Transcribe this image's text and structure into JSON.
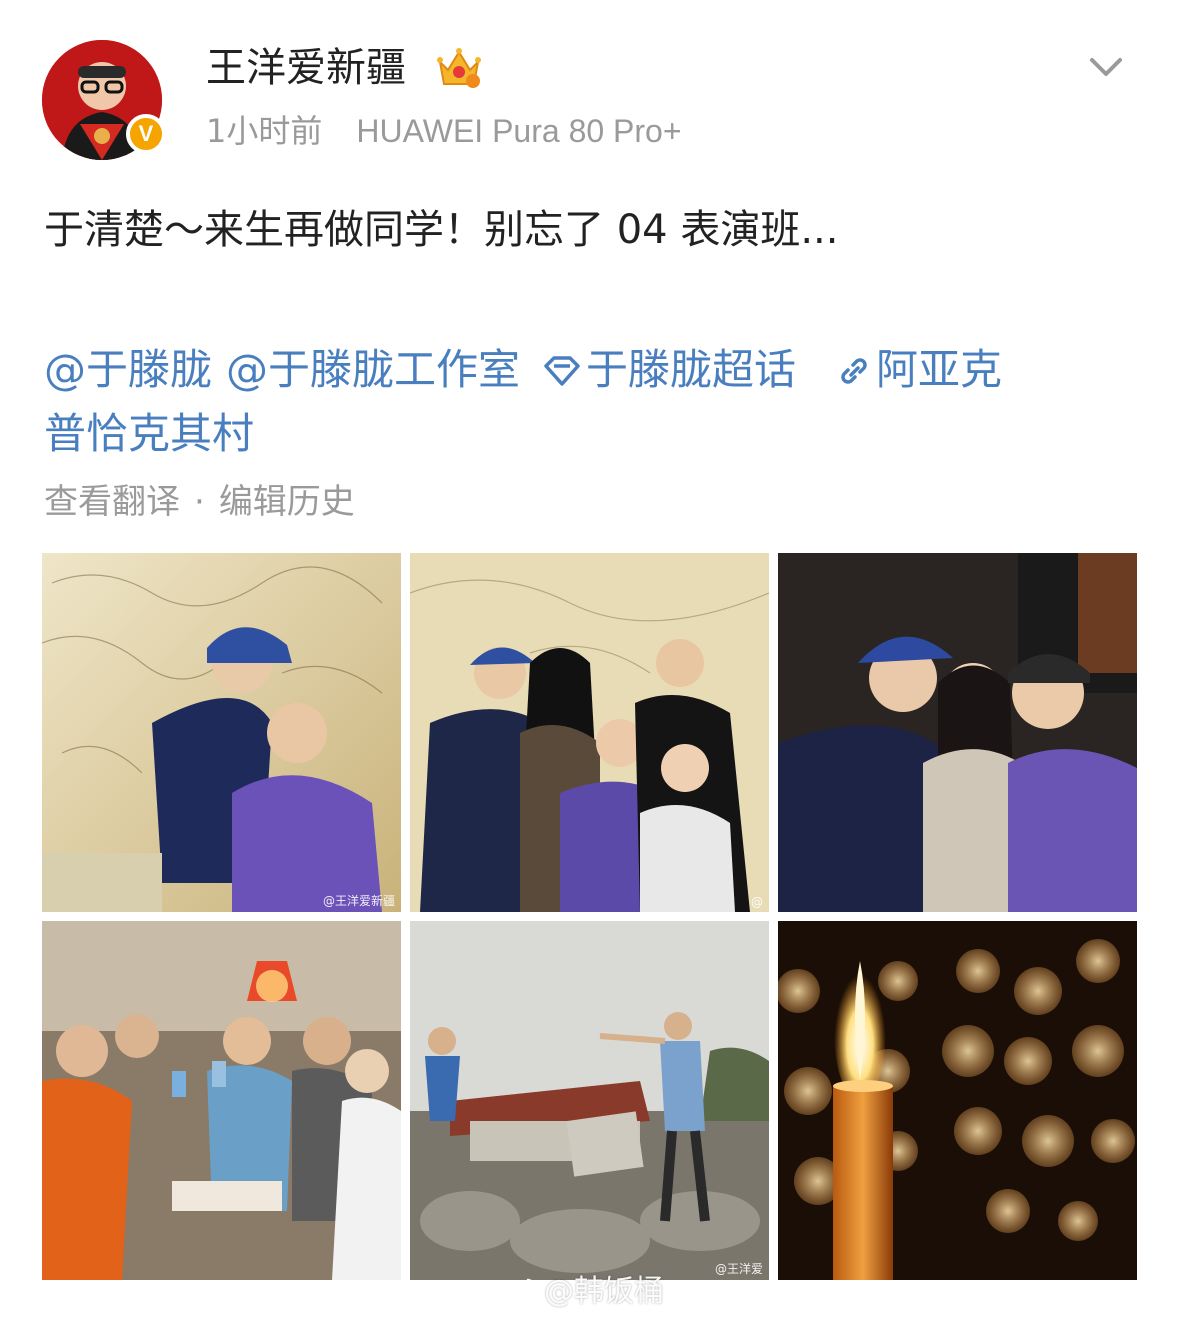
{
  "post": {
    "author": "王洋爱新疆",
    "verified_mark": "V",
    "time": "1小时前",
    "device": "HUAWEI Pura 80 Pro+",
    "text": "于清楚～来生再做同学！别忘了 04 表演班...",
    "mentions": [
      "@于滕胧",
      "@于滕胧工作室"
    ],
    "topic": "于滕胧超话",
    "location": "阿亚克普恰克其村",
    "location_line1": "阿亚克",
    "location_line2": "普恰克其村",
    "translate_label": "查看翻译",
    "separator": "·",
    "edit_history_label": "编辑历史"
  },
  "photos": [
    {
      "watermark": "@王洋爱新疆"
    },
    {
      "watermark": "@"
    },
    {
      "watermark": ""
    },
    {
      "watermark": ""
    },
    {
      "watermark": "@王洋爱"
    },
    {
      "watermark": ""
    }
  ],
  "page_watermark": "@韩饭桶",
  "colors": {
    "link": "#4a7fbf",
    "secondary_text": "#9a9a9a",
    "verified": "#f5a400"
  },
  "icons": [
    "chevron-down-icon",
    "crown-badge-icon",
    "topic-diamond-icon",
    "link-icon",
    "weibo-logo-icon"
  ]
}
